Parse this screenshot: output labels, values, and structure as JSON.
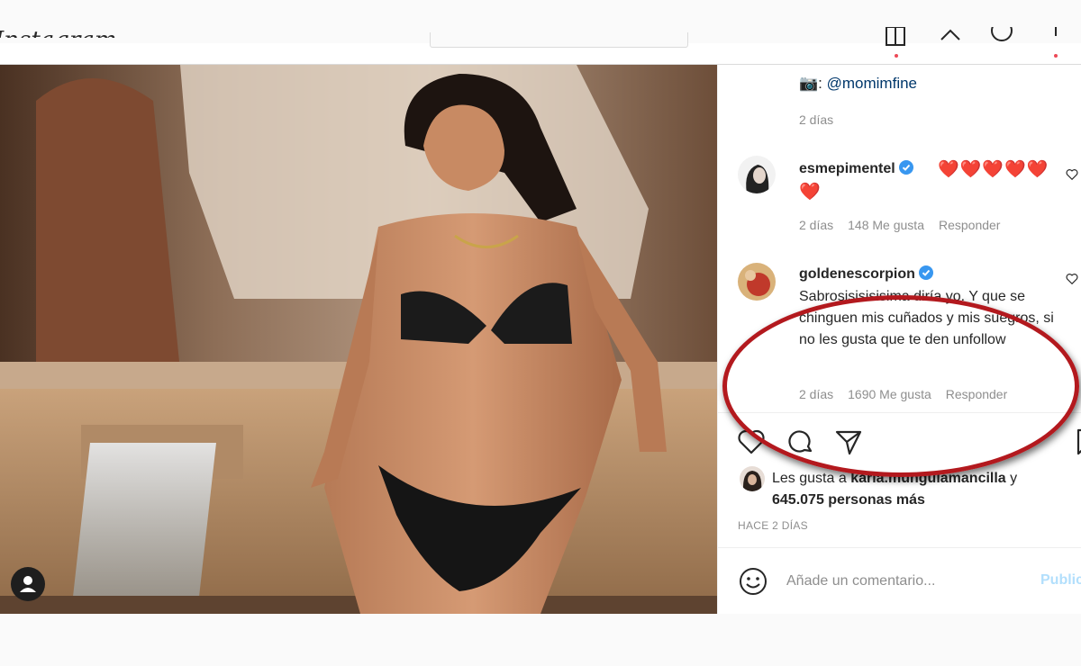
{
  "app": {
    "logo_text": "Instagram"
  },
  "post": {
    "caption_credit_icon": "camera-emoji",
    "caption_credit_handle": "@momimfine",
    "caption_time": "2 días",
    "comments": [
      {
        "username": "esmepimentel",
        "verified": true,
        "text": "❤️❤️❤️❤️❤️",
        "text_line2": "❤️",
        "time": "2 días",
        "likes": "148 Me gusta",
        "reply": "Responder"
      },
      {
        "username": "goldenescorpion",
        "verified": true,
        "text": "Sabrosisisisisima diría yo. Y que se chinguen mis cuñados y mis suegros, si no les gusta que te den unfollow",
        "time": "2 días",
        "likes": "1690 Me gusta",
        "reply": "Responder"
      }
    ],
    "likes_prefix": "Les gusta a",
    "likes_user": "karla.munguiamancilla",
    "likes_joiner": "y",
    "likes_count": "645.075 personas más",
    "posted_ago": "HACE 2 DÍAS",
    "comment_placeholder": "Añade un comentario...",
    "publish_label": "Publicar"
  },
  "colors": {
    "verified": "#3897f0",
    "highlight_ring": "#b3191e",
    "heart": "#e0245e",
    "link": "#00376b"
  },
  "icons": [
    "heart-icon",
    "comment-icon",
    "share-icon",
    "bookmark-icon",
    "emoji-icon",
    "user-tag-icon",
    "verified-badge-icon"
  ]
}
